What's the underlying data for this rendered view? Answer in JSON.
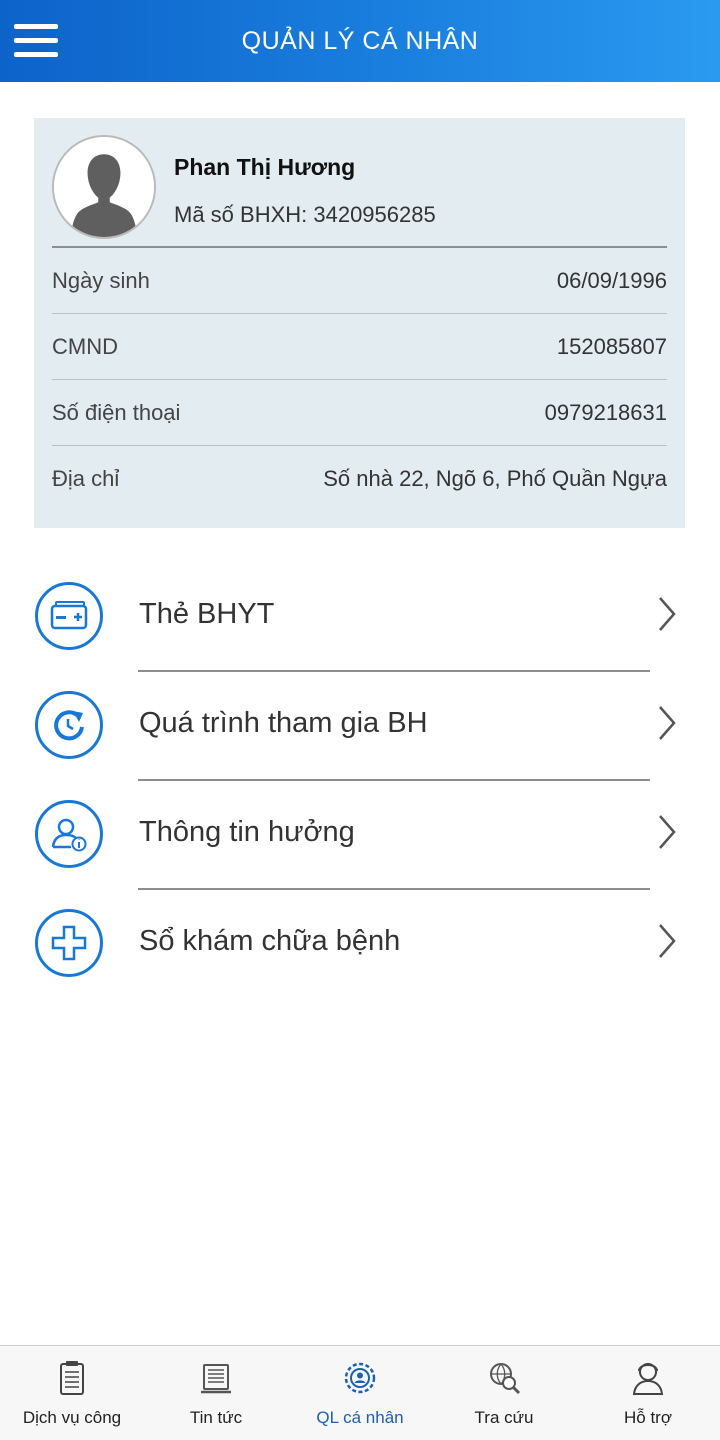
{
  "header": {
    "title": "QUẢN LÝ CÁ NHÂN",
    "menu_icon": "hamburger-menu-icon"
  },
  "profile": {
    "name": "Phan Thị Hương",
    "code_text": "Mã số BHXH: 3420956285",
    "avatar_icon": "person-silhouette-icon",
    "rows": [
      {
        "label": "Ngày sinh",
        "value": "06/09/1996"
      },
      {
        "label": "CMND",
        "value": "152085807"
      },
      {
        "label": "Số điện thoại",
        "value": "0979218631"
      },
      {
        "label": "Địa chỉ",
        "value": "Số nhà 22, Ngõ 6, Phố Quần Ngựa"
      }
    ]
  },
  "menu": [
    {
      "label": "Thẻ BHYT",
      "icon": "health-card-icon"
    },
    {
      "label": "Quá trình tham gia BH",
      "icon": "history-refresh-icon"
    },
    {
      "label": "Thông tin hưởng",
      "icon": "user-info-icon"
    },
    {
      "label": "Sổ khám chữa bệnh",
      "icon": "medical-cross-icon"
    }
  ],
  "bottom_nav": {
    "items": [
      {
        "label": "Dịch vụ công",
        "icon": "clipboard-icon"
      },
      {
        "label": "Tin tức",
        "icon": "news-icon"
      },
      {
        "label": "QL cá nhân",
        "icon": "gear-user-icon",
        "active": true
      },
      {
        "label": "Tra cứu",
        "icon": "globe-search-icon"
      },
      {
        "label": "Hỗ trợ",
        "icon": "support-person-icon"
      }
    ]
  },
  "colors": {
    "header_start": "#0d63c9",
    "header_end": "#2a9af0",
    "card_bg": "#e3ecf0",
    "accent": "#1778d8",
    "active_nav": "#1d5fb5"
  }
}
